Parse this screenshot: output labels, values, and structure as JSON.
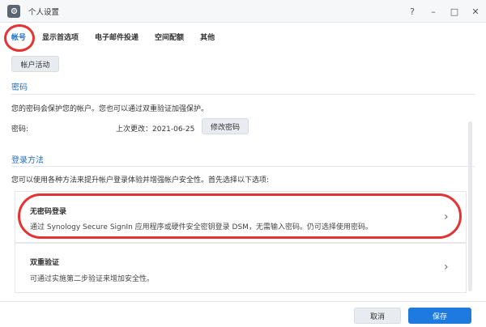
{
  "window": {
    "title": "个人设置",
    "controls": [
      "?",
      "–",
      "□",
      "✕"
    ]
  },
  "tabs": [
    {
      "label": "帐号",
      "active": true
    },
    {
      "label": "显示首选项",
      "active": false
    },
    {
      "label": "电子邮件投递",
      "active": false
    },
    {
      "label": "空间配额",
      "active": false
    },
    {
      "label": "其他",
      "active": false
    }
  ],
  "account_activity_label": "帐户活动",
  "password": {
    "heading": "密码",
    "description": "您的密码会保护您的帐户。您也可以通过双重验证加强保护。",
    "label": "密码:",
    "last_changed": "上次更改：2021-06-25",
    "change_button": "修改密码"
  },
  "login": {
    "heading": "登录方法",
    "description": "您可以使用各种方法来提升帐户登录体验并增强帐户安全性。首先选择以下选项:",
    "options": [
      {
        "title": "无密码登录",
        "description": "通过 Synology Secure SignIn 应用程序或硬件安全密钥登录 DSM，无需输入密码。仍可选择使用密码。"
      },
      {
        "title": "双重验证",
        "description": "可通过实施第二步验证来增加安全性。"
      }
    ]
  },
  "footer": {
    "cancel": "取消",
    "save": "保存"
  },
  "colors": {
    "accent": "#1f6fbf",
    "primary_button": "#1f7ae0",
    "annotation": "#e53232"
  }
}
